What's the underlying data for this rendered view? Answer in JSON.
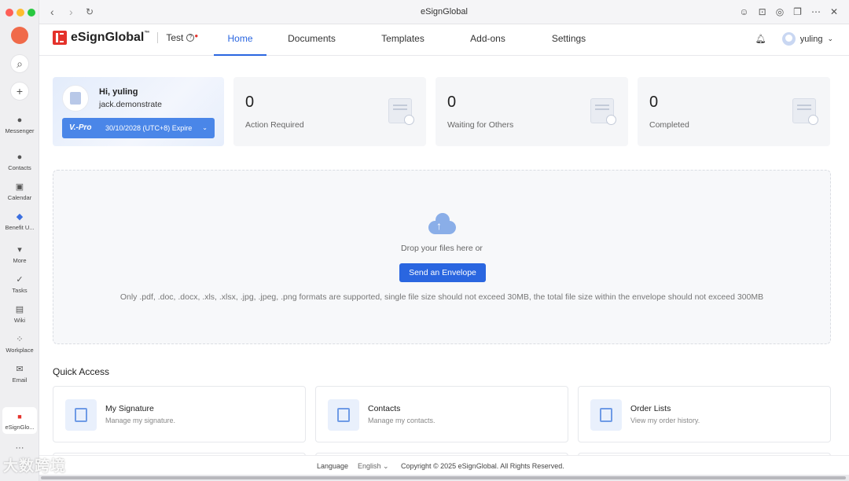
{
  "window": {
    "title": "eSignGlobal"
  },
  "sidebar": {
    "items": [
      {
        "label": "Messenger"
      },
      {
        "label": "Contacts"
      },
      {
        "label": "Calendar"
      },
      {
        "label": "Benefit U..."
      },
      {
        "label": "More"
      },
      {
        "label": "Tasks"
      },
      {
        "label": "Wiki"
      },
      {
        "label": "Workplace"
      },
      {
        "label": "Email"
      },
      {
        "label": "eSignGlo..."
      }
    ],
    "more_dots": "···"
  },
  "header": {
    "brand": "eSignGlobal",
    "trademark": "™",
    "env_label": "Test",
    "env_help": "?",
    "tabs": [
      {
        "label": "Home",
        "active": true
      },
      {
        "label": "Documents"
      },
      {
        "label": "Templates"
      },
      {
        "label": "Add-ons"
      },
      {
        "label": "Settings"
      }
    ],
    "user_name": "yuling"
  },
  "user_card": {
    "greeting": "Hi, yuling",
    "account": "jack.demonstrate",
    "plan_badge": "V.-Pro",
    "plan_expiry": "30/10/2028 (UTC+8) Expire"
  },
  "stats": [
    {
      "value": "0",
      "label": "Action Required"
    },
    {
      "value": "0",
      "label": "Waiting for Others"
    },
    {
      "value": "0",
      "label": "Completed"
    }
  ],
  "upload": {
    "prompt": "Drop your files here or",
    "button": "Send an Envelope",
    "note": "Only .pdf, .doc, .docx, .xls, .xlsx, .jpg, .jpeg, .png formats are supported, single file size should not exceed 30MB, the total file size within the envelope should not exceed 300MB"
  },
  "quick_access": {
    "title": "Quick Access",
    "items": [
      {
        "name": "My Signature",
        "desc": "Manage my signature."
      },
      {
        "name": "Contacts",
        "desc": "Manage my contacts."
      },
      {
        "name": "Order Lists",
        "desc": "View my order history."
      }
    ]
  },
  "footer": {
    "language_label": "Language",
    "language_value": "English",
    "copyright": "Copyright © 2025 eSignGlobal. All Rights Reserved."
  },
  "watermark": "大数跨境",
  "colors": {
    "accent": "#2a66e0",
    "brand_red": "#e4322b",
    "plan_blue": "#4a86e8"
  }
}
